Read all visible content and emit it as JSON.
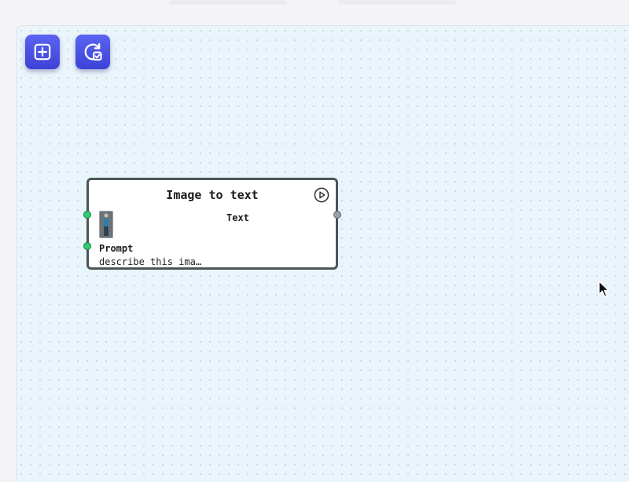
{
  "toolbar": {
    "add_button_icon": "plus-square-icon",
    "refresh_button_icon": "refresh-check-icon",
    "accent_color": "#4a51e3"
  },
  "node": {
    "title": "Image to text",
    "output_label": "Text",
    "prompt_label": "Prompt",
    "prompt_value": "describe this ima…",
    "run_icon": "play-circle-icon",
    "input_port_color": "#2fcc72",
    "output_port_color": "#9aa0a5"
  }
}
